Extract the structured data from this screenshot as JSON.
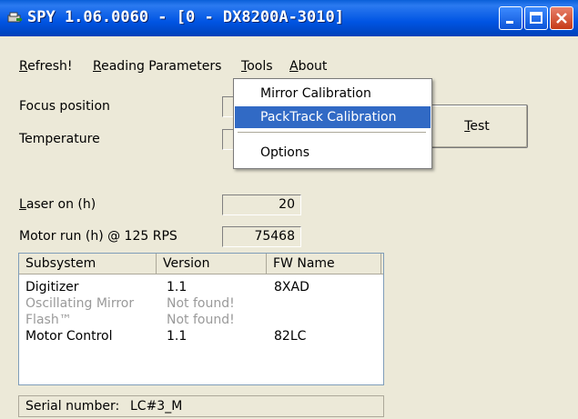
{
  "window": {
    "title": "SPY 1.06.0060 - [0 - DX8200A-3010]",
    "app_icon": "scanner-app-icon",
    "title_bar_color": "#0054e3"
  },
  "menu": {
    "refresh": "Refresh!",
    "reading_parameters": "Reading Parameters",
    "tools": "Tools",
    "about": "About"
  },
  "tools_menu": {
    "mirror_calibration": "Mirror Calibration",
    "packtrack_calibration": "PackTrack Calibration",
    "options": "Options",
    "highlight_color": "#316ac5"
  },
  "fields": {
    "focus_position_label": "Focus position",
    "focus_position_value": "",
    "temperature_label": "Temperature",
    "temperature_value": "",
    "laser_on_label": "Laser on (h)",
    "laser_on_value": "20",
    "motor_run_label": "Motor run (h) @ 125 RPS",
    "motor_run_value": "75468"
  },
  "test_button": "Test",
  "subsystems": {
    "columns": [
      "Subsystem",
      "Version",
      "FW Name"
    ],
    "rows": [
      {
        "subsystem": "Digitizer",
        "version": "1.1",
        "fw_name": "8XAD",
        "found": true
      },
      {
        "subsystem": "Oscillating Mirror",
        "version": "Not found!",
        "fw_name": "",
        "found": false
      },
      {
        "subsystem": "Flash™",
        "version": "Not found!",
        "fw_name": "",
        "found": false
      },
      {
        "subsystem": "Motor Control",
        "version": "1.1",
        "fw_name": "82LC",
        "found": true
      }
    ]
  },
  "serial": {
    "label": "Serial number:",
    "value": "LC#3_M"
  }
}
